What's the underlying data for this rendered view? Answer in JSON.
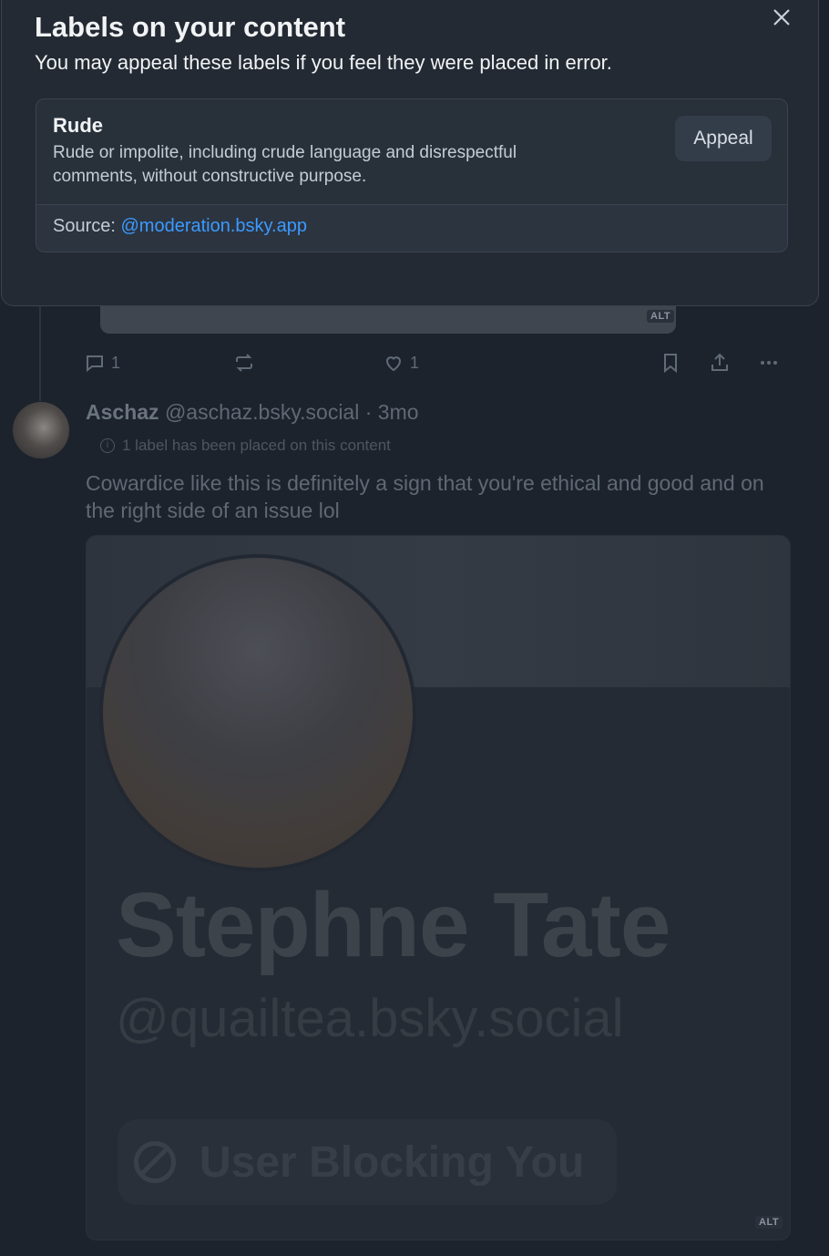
{
  "dialog": {
    "title": "Labels on your content",
    "subtitle": "You may appeal these labels if you feel they were placed in error.",
    "close_icon": "close-icon",
    "label": {
      "name": "Rude",
      "description": "Rude or impolite, including crude language and disrespectful comments, without constructive purpose.",
      "appeal_label": "Appeal",
      "source_prefix": "Source: ",
      "source_handle": "@moderation.bsky.app"
    }
  },
  "background_feed": {
    "previous_post": {
      "alt_badge": "ALT",
      "reply_count": "1",
      "like_count": "1",
      "icons": [
        "reply-icon",
        "repost-icon",
        "like-icon",
        "bookmark-icon",
        "share-icon",
        "more-icon"
      ]
    },
    "post": {
      "author_name": "Aschaz",
      "author_handle": "@aschaz.bsky.social",
      "separator": " · ",
      "time": "3mo",
      "label_notice": "1 label has been placed on this content",
      "text": "Cowardice like this is definitely a sign that you're ethical and good and on the right side of an issue lol",
      "embed": {
        "display_name": "Stephne Tate",
        "handle": "@quailtea.bsky.social",
        "block_status": "User Blocking You",
        "alt_badge": "ALT"
      }
    }
  },
  "colors": {
    "background": "#1d232c",
    "dialog_bg": "#232a33",
    "link": "#3b9aff",
    "appeal_button_bg": "#333d4a"
  }
}
